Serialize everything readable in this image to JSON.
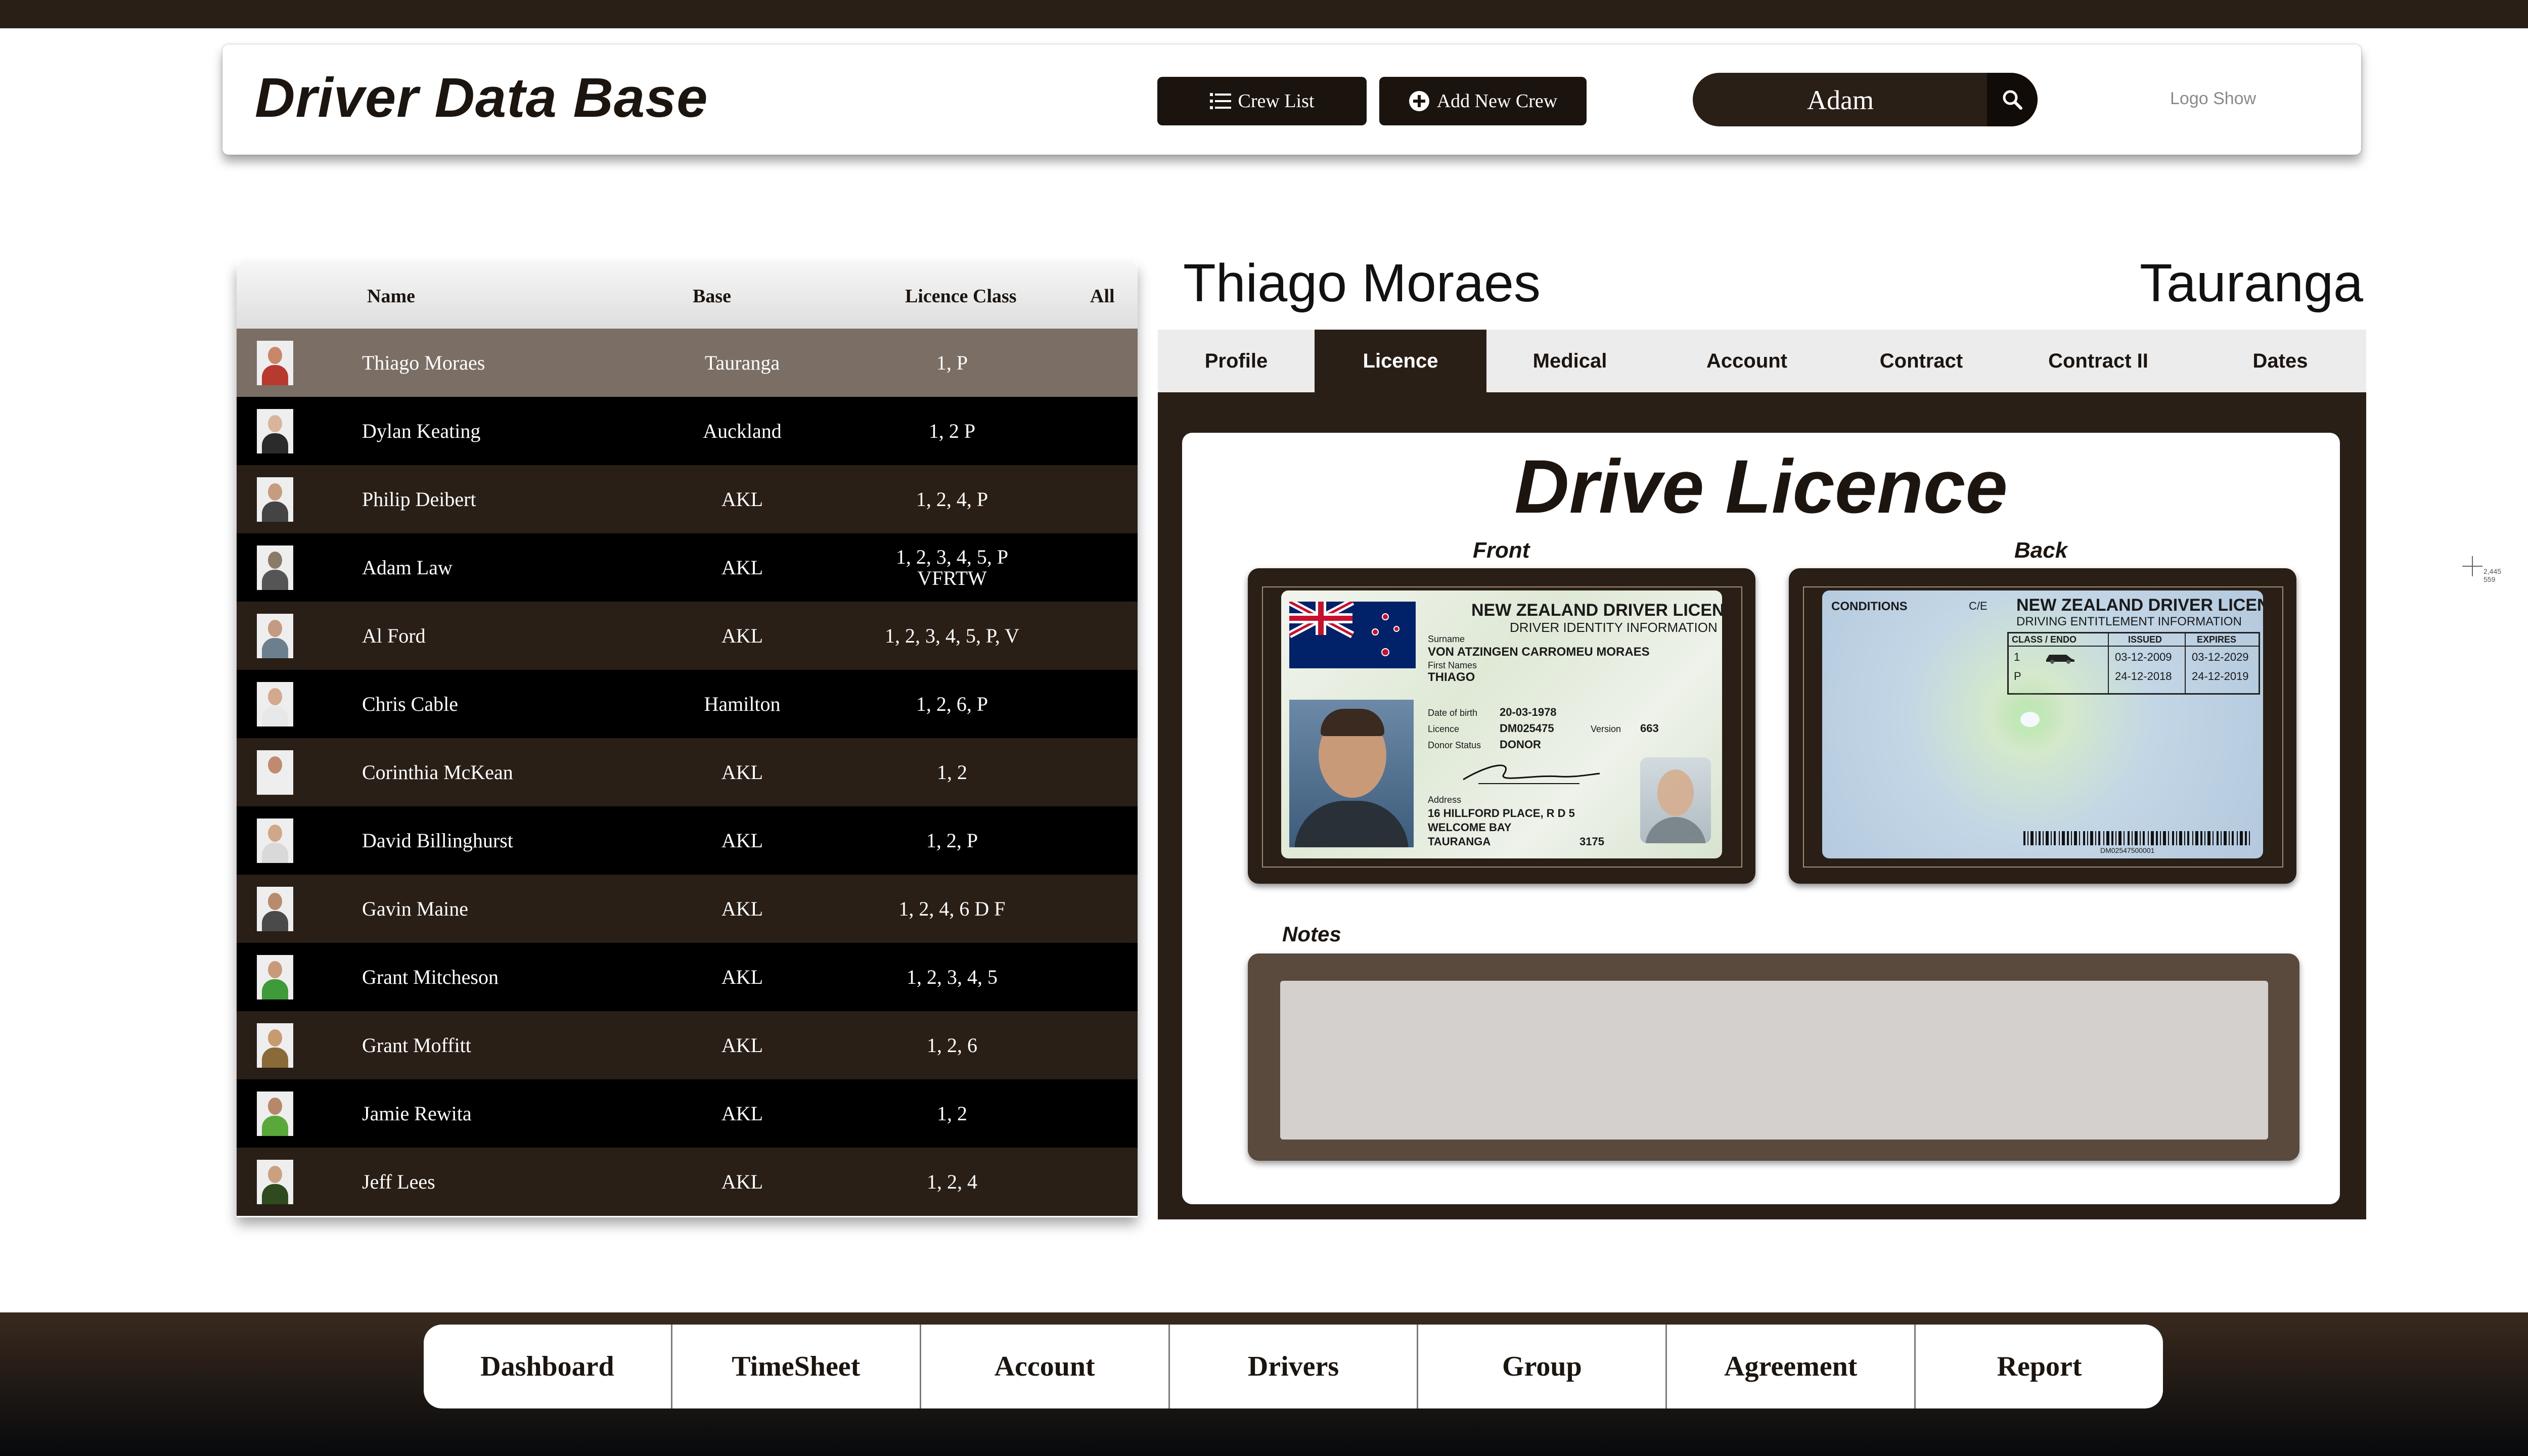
{
  "header": {
    "title": "Driver Data Base",
    "crew_list_label": "Crew List",
    "add_crew_label": "Add New Crew",
    "search_value": "Adam",
    "logo_label": "Logo Show"
  },
  "crew_table": {
    "columns": {
      "name": "Name",
      "base": "Base",
      "licence": "Licence Class",
      "filter": "All"
    },
    "rows": [
      {
        "name": "Thiago Moraes",
        "base": "Tauranga",
        "licence": "1, P"
      },
      {
        "name": "Dylan Keating",
        "base": "Auckland",
        "licence": "1, 2 P"
      },
      {
        "name": "Philip Deibert",
        "base": "AKL",
        "licence": "1, 2, 4, P"
      },
      {
        "name": "Adam Law",
        "base": "AKL",
        "licence": "1, 2, 3, 4, 5, P VFRTW"
      },
      {
        "name": "Al Ford",
        "base": "AKL",
        "licence": "1, 2, 3, 4, 5, P, V"
      },
      {
        "name": "Chris Cable",
        "base": "Hamilton",
        "licence": "1, 2, 6, P"
      },
      {
        "name": "Corinthia McKean",
        "base": "AKL",
        "licence": "1, 2"
      },
      {
        "name": "David Billinghurst",
        "base": "AKL",
        "licence": "1, 2, P"
      },
      {
        "name": "Gavin Maine",
        "base": "AKL",
        "licence": "1, 2, 4, 6 D F"
      },
      {
        "name": "Grant Mitcheson",
        "base": "AKL",
        "licence": "1, 2, 3, 4, 5"
      },
      {
        "name": "Grant Moffitt",
        "base": "AKL",
        "licence": "1, 2, 6"
      },
      {
        "name": "Jamie Rewita",
        "base": "AKL",
        "licence": "1, 2"
      },
      {
        "name": "Jeff Lees",
        "base": "AKL",
        "licence": "1, 2, 4"
      }
    ]
  },
  "selected": {
    "name": "Thiago Moraes",
    "base": "Tauranga"
  },
  "tabs": [
    {
      "label": "Profile"
    },
    {
      "label": "Licence"
    },
    {
      "label": "Medical"
    },
    {
      "label": "Account"
    },
    {
      "label": "Contract"
    },
    {
      "label": "Contract II"
    },
    {
      "label": "Dates"
    }
  ],
  "licence": {
    "title": "Drive Licence",
    "front_label": "Front",
    "back_label": "Back",
    "front": {
      "heading": "NEW ZEALAND DRIVER LICENCE",
      "subheading": "DRIVER IDENTITY INFORMATION",
      "surname_label": "Surname",
      "surname": "VON ATZINGEN CARROMEU MORAES",
      "first_label": "First Names",
      "first": "THIAGO",
      "dob_label": "Date of birth",
      "dob": "20-03-1978",
      "licence_label": "Licence",
      "licence_no": "DM025475",
      "version_label": "Version",
      "version": "663",
      "donor_label": "Donor Status",
      "donor": "DONOR",
      "address_label": "Address",
      "address1": "16 HILLFORD PLACE, R D 5",
      "address2": "WELCOME BAY",
      "address3": "TAURANGA",
      "postcode": "3175"
    },
    "back": {
      "conditions": "CONDITIONS",
      "ce": "C/E",
      "heading": "NEW ZEALAND DRIVER LICENCE",
      "subheading": "DRIVING ENTITLEMENT INFORMATION",
      "col_class": "CLASS / ENDO",
      "col_issued": "ISSUED",
      "col_expires": "EXPIRES",
      "row1_class": "1",
      "row1_issued": "03-12-2009",
      "row1_expires": "03-12-2029",
      "row2_class": "P",
      "row2_issued": "24-12-2018",
      "row2_expires": "24-12-2019",
      "barcode_text": "DM02547500001"
    },
    "notes_label": "Notes",
    "notes_value": ""
  },
  "cursor_readout": {
    "x": "2,445",
    "y": "559"
  },
  "bottom_nav": [
    {
      "label": "Dashboard"
    },
    {
      "label": "TimeSheet"
    },
    {
      "label": "Account"
    },
    {
      "label": "Drivers"
    },
    {
      "label": "Group"
    },
    {
      "label": "Agreement"
    },
    {
      "label": "Report"
    }
  ],
  "colors": {
    "dark_brown": "#2a1f16",
    "row_dark": "#000000",
    "row_brown": "#2a1f16",
    "row_selected": "#7b6e64"
  }
}
